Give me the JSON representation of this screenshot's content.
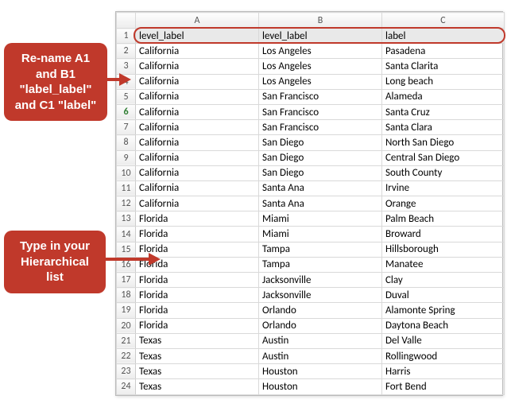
{
  "columns": [
    "A",
    "B",
    "C"
  ],
  "callouts": {
    "rename": "Re-name A1 and B1 \"label_label\" and C1 \"label\"",
    "type": "Type in your Hierarchical list"
  },
  "selected_row_index": 0,
  "active_row_header_index": 5,
  "rows": [
    {
      "n": 1,
      "a": "level_label",
      "b": "level_label",
      "c": "label"
    },
    {
      "n": 2,
      "a": "California",
      "b": "Los Angeles",
      "c": "Pasadena"
    },
    {
      "n": 3,
      "a": "California",
      "b": "Los Angeles",
      "c": "Santa Clarita"
    },
    {
      "n": 4,
      "a": "California",
      "b": "Los Angeles",
      "c": "Long beach"
    },
    {
      "n": 5,
      "a": "California",
      "b": "San Francisco",
      "c": "Alameda"
    },
    {
      "n": 6,
      "a": "California",
      "b": "San Francisco",
      "c": "Santa Cruz"
    },
    {
      "n": 7,
      "a": "California",
      "b": "San Francisco",
      "c": "Santa Clara"
    },
    {
      "n": 8,
      "a": "California",
      "b": "San Diego",
      "c": "North San Diego"
    },
    {
      "n": 9,
      "a": "California",
      "b": "San Diego",
      "c": "Central San Diego"
    },
    {
      "n": 10,
      "a": "California",
      "b": "San Diego",
      "c": "South County"
    },
    {
      "n": 11,
      "a": "California",
      "b": "Santa Ana",
      "c": "Irvine"
    },
    {
      "n": 12,
      "a": "California",
      "b": "Santa Ana",
      "c": "Orange"
    },
    {
      "n": 13,
      "a": "Florida",
      "b": "Miami",
      "c": "Palm Beach"
    },
    {
      "n": 14,
      "a": "Florida",
      "b": "Miami",
      "c": " Broward"
    },
    {
      "n": 15,
      "a": "Florida",
      "b": "Tampa",
      "c": "Hillsborough"
    },
    {
      "n": 16,
      "a": "Florida",
      "b": "Tampa",
      "c": "Manatee"
    },
    {
      "n": 17,
      "a": "Florida",
      "b": "Jacksonville",
      "c": "Clay"
    },
    {
      "n": 18,
      "a": "Florida",
      "b": "Jacksonville",
      "c": "Duval"
    },
    {
      "n": 19,
      "a": "Florida",
      "b": "Orlando",
      "c": "Alamonte Spring"
    },
    {
      "n": 20,
      "a": "Florida",
      "b": "Orlando",
      "c": "Daytona Beach"
    },
    {
      "n": 21,
      "a": "Texas",
      "b": "Austin",
      "c": "Del Valle"
    },
    {
      "n": 22,
      "a": "Texas",
      "b": "Austin",
      "c": "Rollingwood"
    },
    {
      "n": 23,
      "a": "Texas",
      "b": "Houston",
      "c": "Harris"
    },
    {
      "n": 24,
      "a": "Texas",
      "b": "Houston",
      "c": "Fort Bend"
    }
  ]
}
